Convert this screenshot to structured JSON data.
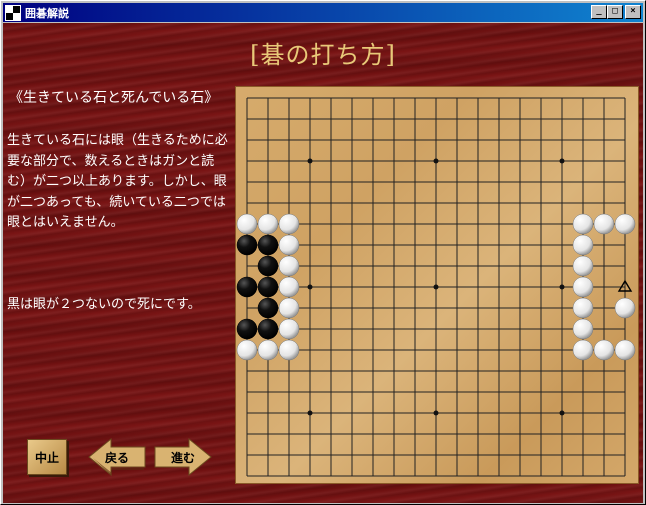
{
  "window": {
    "title": "囲碁解説",
    "minimize_symbol": "_",
    "maximize_symbol": "□",
    "close_symbol": "×"
  },
  "heading": "[碁の打ち方]",
  "section_title": "《生きている石と死んでいる石》",
  "explanation": "生きている石には眼（生きるために必要な部分で、数えるときはガンと読む）が二つ以上あります。しかし、眼が二つあっても、続いている二つでは眼とはいえません。",
  "conclusion": "黒は眼が２つないので死にです。",
  "buttons": {
    "stop": "中止",
    "back": "戻る",
    "forward": "進む"
  },
  "board": {
    "size": 19,
    "star_points": [
      [
        3,
        3
      ],
      [
        3,
        9
      ],
      [
        3,
        15
      ],
      [
        9,
        3
      ],
      [
        9,
        9
      ],
      [
        9,
        15
      ],
      [
        15,
        3
      ],
      [
        15,
        9
      ],
      [
        15,
        15
      ]
    ],
    "white_stones": [
      [
        0,
        6
      ],
      [
        1,
        6
      ],
      [
        2,
        6
      ],
      [
        2,
        7
      ],
      [
        2,
        8
      ],
      [
        2,
        9
      ],
      [
        2,
        10
      ],
      [
        2,
        11
      ],
      [
        2,
        12
      ],
      [
        0,
        12
      ],
      [
        1,
        12
      ],
      [
        16,
        6
      ],
      [
        17,
        6
      ],
      [
        18,
        6
      ],
      [
        16,
        7
      ],
      [
        16,
        8
      ],
      [
        16,
        9
      ],
      [
        16,
        10
      ],
      [
        16,
        11
      ],
      [
        16,
        12
      ],
      [
        17,
        12
      ],
      [
        18,
        12
      ],
      [
        18,
        10
      ]
    ],
    "black_stones": [
      [
        0,
        7
      ],
      [
        1,
        7
      ],
      [
        1,
        8
      ],
      [
        0,
        9
      ],
      [
        1,
        9
      ],
      [
        1,
        10
      ],
      [
        0,
        11
      ],
      [
        1,
        11
      ]
    ],
    "marker": {
      "type": "triangle",
      "pos": [
        18,
        9
      ]
    }
  },
  "colors": {
    "background_wood": "#7a1414",
    "heading": "#e8c979",
    "board": "#d6ab6c"
  }
}
